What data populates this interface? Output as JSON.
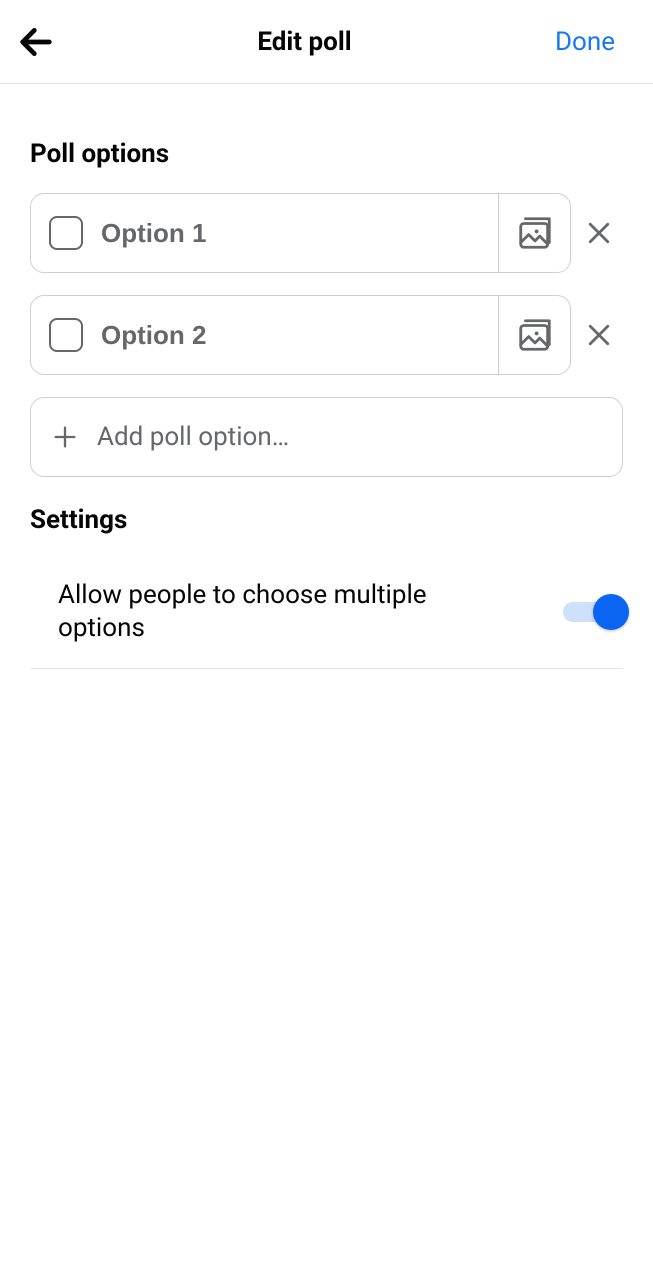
{
  "header": {
    "title": "Edit poll",
    "done_label": "Done"
  },
  "sections": {
    "options_title": "Poll options",
    "settings_title": "Settings"
  },
  "options": [
    {
      "placeholder": "Option 1"
    },
    {
      "placeholder": "Option 2"
    }
  ],
  "add_option_label": "Add poll option…",
  "settings": {
    "multiple": {
      "label": "Allow people to choose multiple options",
      "enabled": true
    }
  }
}
